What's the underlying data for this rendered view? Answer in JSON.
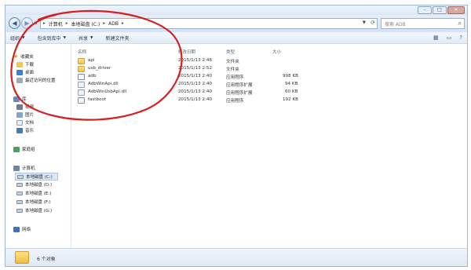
{
  "window": {
    "controls": [
      "–",
      "□",
      "✕"
    ]
  },
  "address": {
    "crumbs": [
      "计算机",
      "本地磁盘 (C:)",
      "ADB"
    ],
    "search_placeholder": "搜索 ADB"
  },
  "toolbar": {
    "organize": "组织",
    "include_library": "包含到库中",
    "share": "共享",
    "new_folder": "新建文件夹"
  },
  "nav": {
    "favorites": "收藏夹",
    "downloads": "下载",
    "desktop": "桌面",
    "recent": "最近访问的位置",
    "libraries": "库",
    "videos": "视频",
    "pictures": "图片",
    "documents": "文档",
    "music": "音乐",
    "homegroup": "家庭组",
    "computer": "计算机",
    "drives": [
      "本地磁盘 (C:)",
      "本地磁盘 (D:)",
      "本地磁盘 (E:)",
      "本地磁盘 (F:)",
      "本地磁盘 (G:)"
    ],
    "network": "网络"
  },
  "columns": {
    "name": "名称",
    "modified": "修改日期",
    "type": "类型",
    "size": "大小"
  },
  "files": [
    {
      "name": "api",
      "modified": "2015/1/13 2:46",
      "type": "文件夹",
      "size": "",
      "kind": "folder"
    },
    {
      "name": "usb_driver",
      "modified": "2015/1/13 2:52",
      "type": "文件夹",
      "size": "",
      "kind": "folder"
    },
    {
      "name": "adb",
      "modified": "2015/1/13 2:40",
      "type": "应用程序",
      "size": "998 KB",
      "kind": "exe"
    },
    {
      "name": "AdbWinApi.dll",
      "modified": "2015/1/13 2:40",
      "type": "应用程序扩展",
      "size": "94 KB",
      "kind": "dll"
    },
    {
      "name": "AdbWinUsbApi.dll",
      "modified": "2015/1/13 2:40",
      "type": "应用程序扩展",
      "size": "60 KB",
      "kind": "dll"
    },
    {
      "name": "fastboot",
      "modified": "2015/1/13 2:40",
      "type": "应用程序",
      "size": "192 KB",
      "kind": "exe"
    }
  ],
  "status": {
    "item_count": "6 个对象"
  }
}
